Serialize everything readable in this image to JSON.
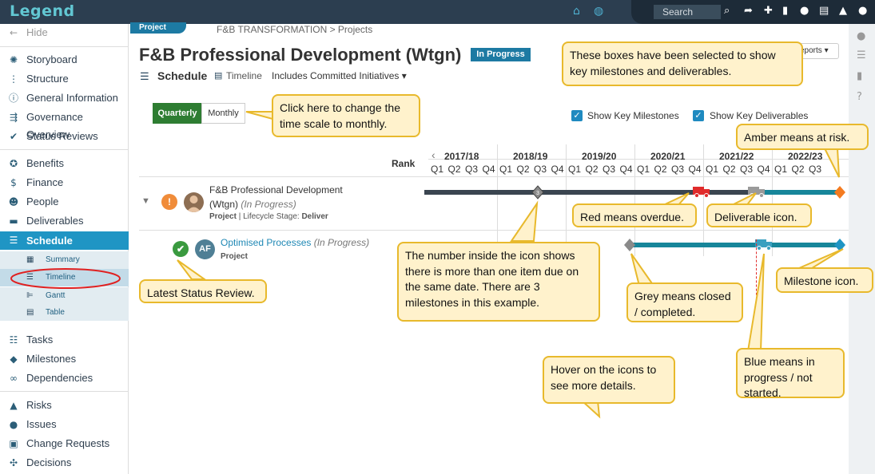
{
  "app": {
    "logo": "Legend",
    "search_placeholder": "Search"
  },
  "topbar": {
    "icons": [
      "home-icon",
      "globe-icon",
      "search-icon",
      "share-icon",
      "plus-icon",
      "bookmark-icon",
      "chat-icon",
      "document-icon",
      "bell-icon",
      "user-icon"
    ]
  },
  "sidebar": {
    "hide_label": "Hide",
    "items": [
      {
        "label": "Storyboard",
        "icon": "storyboard-icon"
      },
      {
        "label": "Structure",
        "icon": "structure-icon"
      },
      {
        "label": "General Information",
        "icon": "info-icon"
      },
      {
        "label": "Governance Overview",
        "icon": "governance-icon"
      },
      {
        "label": "Status Reviews",
        "icon": "check-icon"
      },
      {
        "label": "Benefits",
        "icon": "benefits-icon"
      },
      {
        "label": "Finance",
        "icon": "dollar-icon"
      },
      {
        "label": "People",
        "icon": "people-icon"
      },
      {
        "label": "Deliverables",
        "icon": "truck-icon"
      },
      {
        "label": "Schedule",
        "icon": "schedule-icon"
      },
      {
        "label": "Tasks",
        "icon": "tasks-icon"
      },
      {
        "label": "Milestones",
        "icon": "diamond-icon"
      },
      {
        "label": "Dependencies",
        "icon": "link-icon"
      },
      {
        "label": "Risks",
        "icon": "warning-icon"
      },
      {
        "label": "Issues",
        "icon": "issue-icon"
      },
      {
        "label": "Change Requests",
        "icon": "change-icon"
      },
      {
        "label": "Decisions",
        "icon": "decisions-icon"
      }
    ],
    "sub_items": [
      "Summary",
      "Timeline",
      "Gantt",
      "Table"
    ]
  },
  "header": {
    "tag": "Project",
    "breadcrumb": "F&B TRANSFORMATION > Projects",
    "title": "F&B Professional Development (Wtgn)",
    "status": "In Progress",
    "reports": "eports ▾"
  },
  "view": {
    "schedule": "Schedule",
    "timeline": "Timeline",
    "includes": "Includes Committed Initiatives",
    "quarterly": "Quarterly",
    "monthly": "Monthly",
    "show_milestones": "Show Key Milestones",
    "show_deliverables": "Show Key Deliverables",
    "rank": "Rank"
  },
  "timeline": {
    "years": [
      "2017/18",
      "2018/19",
      "2019/20",
      "2020/21",
      "2021/22",
      "2022/23"
    ],
    "quarters": [
      "Q1",
      "Q2",
      "Q3",
      "Q4"
    ],
    "visible_last_year_quarters": 3
  },
  "rows": [
    {
      "name": "F&B Professional Development",
      "name2": "(Wtgn)",
      "status": "(In Progress)",
      "type": "Project",
      "lifecycle_label": "| Lifecycle Stage:",
      "lifecycle": "Deliver"
    },
    {
      "name": "Optimised Processes",
      "status": "(In Progress)",
      "type": "Project",
      "avatar": "AF"
    }
  ],
  "callouts": {
    "selected": "These boxes have been selected to show key milestones and deliverables.",
    "monthly": "Click here to change the time scale to monthly.",
    "amber": "Amber means at risk.",
    "red": "Red means overdue.",
    "deliverable": "Deliverable icon.",
    "number": "The number inside the icon shows there is more than one item due on the same date.  There are 3 milestones in this example.",
    "grey": "Grey means closed / completed.",
    "milestone": "Milestone icon.",
    "latest": "Latest Status Review.",
    "hover": "Hover on the icons to see more details.",
    "blue": "Blue means in progress / not started."
  },
  "colors": {
    "topbar": "#2c3e50",
    "accent": "#1f95c4",
    "bar_dark": "#3a4550",
    "bar_blue": "#17869a",
    "amber": "#f47b20",
    "red": "#e02b2b",
    "grey": "#8a8a8a",
    "green": "#2e7d32",
    "callout_bg": "#fff2cc",
    "callout_border": "#e8b92c"
  }
}
